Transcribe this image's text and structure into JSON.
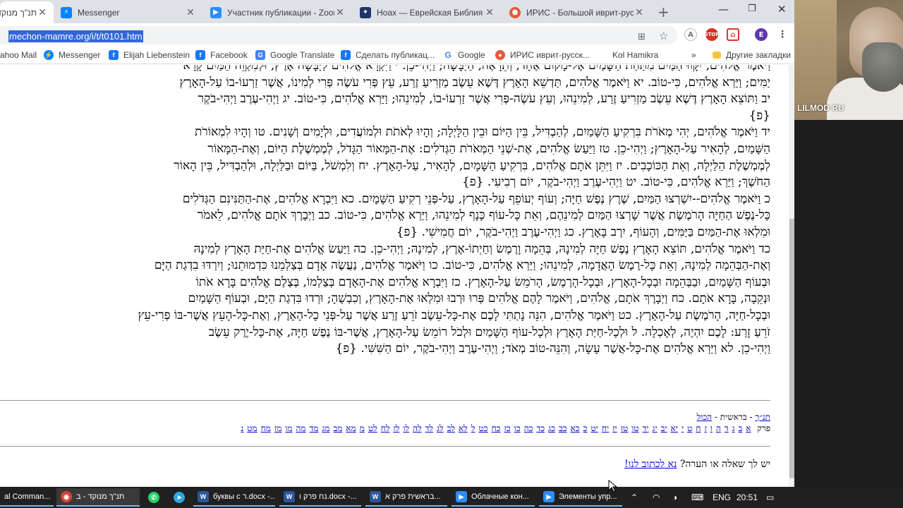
{
  "browser": {
    "tabs": [
      {
        "title": "תנ\"ך מנוקד",
        "favicon": "",
        "color": "#5b7a3a",
        "active": true
      },
      {
        "title": "Messenger",
        "favicon": "messenger-icon",
        "color": "#0084ff",
        "active": false
      },
      {
        "title": "Участник публикации - Zoom",
        "favicon": "zoom-icon",
        "color": "#2d8cff",
        "active": false
      },
      {
        "title": "Ноах — Еврейская Библия Бе",
        "favicon": "site-icon",
        "color": "#223366",
        "active": false
      },
      {
        "title": "ИРИС - Большой иврит-русс",
        "favicon": "iris-icon",
        "color": "#e8583a",
        "active": false
      }
    ],
    "url": "mechon-mamre.org/i/t/t0101.htm",
    "bookmarks": [
      {
        "label": "ahoo Mail",
        "color": "#6001d2"
      },
      {
        "label": "Messenger",
        "color": "#0084ff"
      },
      {
        "label": "Elijah Liebenstein",
        "color": "#1877f2"
      },
      {
        "label": "Facebook",
        "color": "#1877f2"
      },
      {
        "label": "Google Translate",
        "color": "#4285f4"
      },
      {
        "label": "Сделать публикац...",
        "color": "#1877f2"
      },
      {
        "label": "Google",
        "color": "#ea4335"
      },
      {
        "label": "ИРИС иврит-русск...",
        "color": "#e8583a"
      },
      {
        "label": "Kol Hamikra",
        "color": ""
      },
      {
        "label": "»",
        "color": ""
      },
      {
        "label": "Другие закладки",
        "color": "#f4c542"
      }
    ]
  },
  "verses": [
    "וַיֹּאמֶר אֱלֹהִים, יִקָּווּ הַמַּיִם מִתַּחַת הַשָּׁמַיִם אֶל-מָקוֹם אֶחָד, וְתֵרָאֶה, הַיַּבָּשָׁה; וַיְהִי-כֵן. י וַיִּקְרָא אֱלֹהִים לַיַּבָּשָׁה אֶרֶץ, וּלְמִקְוֵה הַמַּיִם קָרָא",
    "יַמִּים; וַיַּרְא אֱלֹהִים, כִּי-טוֹב. יא וַיֹּאמֶר אֱלֹהִים, תַּדְשֵׁא הָאָרֶץ דֶּשֶׁא עֵשֶׂב מַזְרִיעַ זֶרַע, עֵץ פְּרִי עֹשֶׂה פְּרִי לְמִינוֹ, אֲשֶׁר זַרְעוֹ-בוֹ עַל-הָאָרֶץ",
    "יב וַתּוֹצֵא הָאָרֶץ דֶּשֶׁא עֵשֶׂב מַזְרִיעַ זֶרַע, לְמִינֵהוּ, וְעֵץ עֹשֶׂה-פְּרִי אֲשֶׁר זַרְעוֹ-בוֹ, לְמִינֵהוּ; וַיַּרְא אֱלֹהִים, כִּי-טוֹב. יג וַיְהִי-עֶרֶב וַיְהִי-בֹקֶר",
    "{פ}",
    "יד וַיֹּאמֶר אֱלֹהִים, יְהִי מְאֹרֹת בִּרְקִיעַ הַשָּׁמַיִם, לְהַבְדִּיל, בֵּין הַיּוֹם וּבֵין הַלָּיְלָה; וְהָיוּ לְאֹתֹת וּלְמוֹעֲדִים, וּלְיָמִים וְשָׁנִים. טו וְהָיוּ לִמְאוֹרֹת",
    "הַשָּׁמַיִם, לְהָאִיר עַל-הָאָרֶץ; וַיְהִי-כֵן. טז וַיַּעַשׂ אֱלֹהִים, אֶת-שְׁנֵי הַמְּאֹרֹת הַגְּדֹלִים: אֶת-הַמָּאוֹר הַגָּדֹל, לְמֶמְשֶׁלֶת הַיּוֹם, וְאֶת-הַמָּאוֹר",
    "לְמֶמְשֶׁלֶת הַלַּיְלָה, וְאֵת הַכּוֹכָבִים. יז וַיִּתֵּן אֹתָם אֱלֹהִים, בִּרְקִיעַ הַשָּׁמָיִם, לְהָאִיר, עַל-הָאָרֶץ. יח וְלִמְשֹׁל, בַּיּוֹם וּבַלַּיְלָה, וּלְהַבְדִּיל, בֵּין הָאוֹר",
    "הַחֹשֶׁךְ; וַיַּרְא אֱלֹהִים, כִּי-טוֹב. יט וַיְהִי-עֶרֶב וַיְהִי-בֹקֶר, יוֹם רְבִיעִי. {פ}",
    "כ וַיֹּאמֶר אֱלֹהִים--יִשְׁרְצוּ הַמַּיִם, שֶׁרֶץ נֶפֶשׁ חַיָּה; וְעוֹף יְעוֹפֵף עַל-הָאָרֶץ, עַל-פְּנֵי רְקִיעַ הַשָּׁמָיִם. כא וַיִּבְרָא אֱלֹהִים, אֶת-הַתַּנִּינִם הַגְּדֹלִים",
    "כָּל-נֶפֶשׁ הַחַיָּה הָרֹמֶשֶׂת אֲשֶׁר שָׁרְצוּ הַמַּיִם לְמִינֵהֶם, וְאֵת כָּל-עוֹף כָּנָף לְמִינֵהוּ, וַיַּרְא אֱלֹהִים, כִּי-טוֹב. כב וַיְבָרֶךְ אֹתָם אֱלֹהִים, לֵאמֹר",
    "וּמִלְאוּ אֶת-הַמַּיִם בַּיַּמִּים, וְהָעוֹף, יִרֶב בָּאָרֶץ. כג וַיְהִי-עֶרֶב וַיְהִי-בֹקֶר, יוֹם חֲמִישִׁי. {פ}",
    "כד וַיֹּאמֶר אֱלֹהִים, תּוֹצֵא הָאָרֶץ נֶפֶשׁ חַיָּה לְמִינָהּ, בְּהֵמָה וָרֶמֶשׂ וְחַיְתוֹ-אֶרֶץ, לְמִינָהּ; וַיְהִי-כֵן. כה וַיַּעַשׂ אֱלֹהִים אֶת-חַיַּת הָאָרֶץ לְמִינָהּ",
    "וְאֶת-הַבְּהֵמָה לְמִינָהּ, וְאֵת כָּל-רֶמֶשׂ הָאֲדָמָה, לְמִינֵהוּ; וַיַּרְא אֱלֹהִים, כִּי-טוֹב. כו וַיֹּאמֶר אֱלֹהִים, נַעֲשֶׂה אָדָם בְּצַלְמֵנוּ כִּדְמוּתֵנוּ; וְיִרְדּוּ בִדְגַת הַיָּם",
    "וּבְעוֹף הַשָּׁמַיִם, וּבַבְּהֵמָה וּבְכָל-הָאָרֶץ, וּבְכָל-הָרֶמֶשׂ, הָרֹמֵשׂ עַל-הָאָרֶץ. כז וַיִּבְרָא אֱלֹהִים אֶת-הָאָדָם בְּצַלְמוֹ, בְּצֶלֶם אֱלֹהִים בָּרָא אֹתוֹ",
    "וּנְקֵבָה, בָּרָא אֹתָם. כח וַיְבָרֶךְ אֹתָם, אֱלֹהִים, וַיֹּאמֶר לָהֶם אֱלֹהִים פְּרוּ וּרְבוּ וּמִלְאוּ אֶת-הָאָרֶץ, וְכִבְשֻׁהָ; וּרְדוּ בִּדְגַת הַיָּם, וּבְעוֹף הַשָּׁמַיִם",
    "וּבְכָל-חַיָּה, הָרֹמֶשֶׂת עַל-הָאָרֶץ. כט וַיֹּאמֶר אֱלֹהִים, הִנֵּה נָתַתִּי לָכֶם אֶת-כָּל-עֵשֶׂב זֹרֵעַ זֶרַע אֲשֶׁר עַל-פְּנֵי כָל-הָאָרֶץ, וְאֶת-כָּל-הָעֵץ אֲשֶׁר-בּוֹ פְרִי-עֵץ",
    "זֹרֵעַ זָרַע: לָכֶם יִהְיֶה, לְאָכְלָה. ל וּלְכָל-חַיַּת הָאָרֶץ וּלְכָל-עוֹף הַשָּׁמַיִם וּלְכֹל רוֹמֵשׂ עַל-הָאָרֶץ, אֲשֶׁר-בּוֹ נֶפֶשׁ חַיָּה, אֶת-כָּל-יֶרֶק עֵשֶׂב",
    "וַיְהִי-כֵן. לא וַיַּרְא אֱלֹהִים אֶת-כָּל-אֲשֶׁר עָשָׂה, וְהִנֵּה-טוֹב מְאֹד; וַיְהִי-עֶרֶב וַיְהִי-בֹקֶר, יוֹם הַשִּׁשִּׁי. {פ}"
  ],
  "nav": {
    "crumb_tanakh": "תנ״ך",
    "crumb_sep": " - ",
    "crumb_book": "בראשית",
    "crumb_all": "הכול",
    "chapter_label": "פרק",
    "chapters": [
      "א",
      "ב",
      "ג",
      "ד",
      "ה",
      "ו",
      "ז",
      "ח",
      "ט",
      "י",
      "יא",
      "יב",
      "יג",
      "יד",
      "טו",
      "טז",
      "יז",
      "יח",
      "יט",
      "כ",
      "כא",
      "כב",
      "כג",
      "כד",
      "כה",
      "כו",
      "כז",
      "כח",
      "כט",
      "ל",
      "לא",
      "לב",
      "לג",
      "לד",
      "לה",
      "לו",
      "לז",
      "לח",
      "לט",
      "מ",
      "מא",
      "מב",
      "מג",
      "מד",
      "מה",
      "מו",
      "מז",
      "מח",
      "מט",
      "נ"
    ]
  },
  "contact": {
    "text": "יש לך שאלה או הערה?",
    "link": "נא לכתוב לנו!"
  },
  "video": {
    "name": "LILMOD RU"
  },
  "taskbar": {
    "apps": [
      {
        "label": "al Comman...",
        "color": "#2b5797"
      },
      {
        "label": "תנ\"ך מנוקד - ב",
        "color": "#db4437",
        "active": true
      },
      {
        "label": "",
        "color": "#25d366"
      },
      {
        "label": "",
        "color": "#2ca5e0"
      },
      {
        "label": "буквы с ר.docx -...",
        "color": "#2b579a"
      },
      {
        "label": "נח פרק ו.docx -...",
        "color": "#2b579a"
      },
      {
        "label": "בראשית פרק א...",
        "color": "#2b579a"
      },
      {
        "label": "Облачные кон...",
        "color": "#2d8cff"
      },
      {
        "label": "Элементы упр...",
        "color": "#2d8cff"
      }
    ],
    "lang": "ENG",
    "time": "20:51"
  }
}
